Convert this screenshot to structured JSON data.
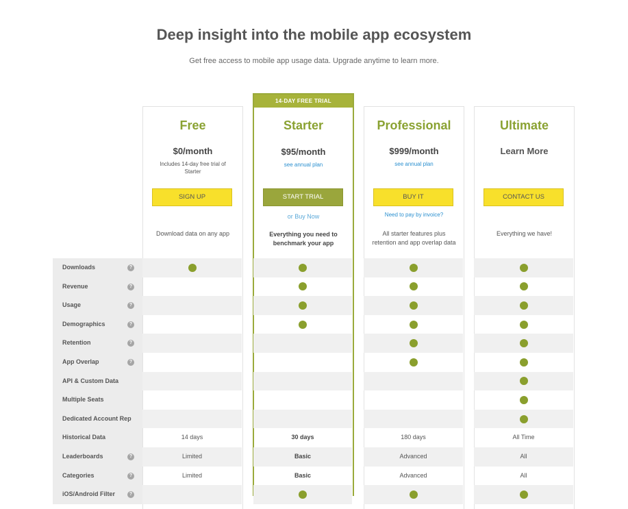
{
  "header": {
    "title": "Deep insight into the mobile app ecosystem",
    "subtitle": "Get free access to mobile app usage data. Upgrade anytime to learn more."
  },
  "plans": [
    {
      "name": "Free",
      "price": "$0/month",
      "note": "Includes 14-day free trial of Starter",
      "button": "SIGN UP",
      "description": "Download data on any app"
    },
    {
      "banner": "14-DAY FREE TRIAL",
      "name": "Starter",
      "price": "$95/month",
      "link": "see annual plan",
      "button": "START TRIAL",
      "sublink": "or Buy Now",
      "description": "Everything you need to benchmark your app"
    },
    {
      "name": "Professional",
      "price": "$999/month",
      "link": "see annual plan",
      "button": "BUY IT",
      "sublink": "Need to pay by invoice?",
      "description": "All starter features plus retention and app overlap data"
    },
    {
      "name": "Ultimate",
      "price": "Learn More",
      "button": "CONTACT US",
      "description": "Everything we have!"
    }
  ],
  "help_symbol": "?",
  "features": [
    {
      "label": "Downloads",
      "help": true,
      "values": [
        "dot",
        "dot",
        "dot",
        "dot"
      ]
    },
    {
      "label": "Revenue",
      "help": true,
      "values": [
        "",
        "dot",
        "dot",
        "dot"
      ]
    },
    {
      "label": "Usage",
      "help": true,
      "values": [
        "",
        "dot",
        "dot",
        "dot"
      ]
    },
    {
      "label": "Demographics",
      "help": true,
      "values": [
        "",
        "dot",
        "dot",
        "dot"
      ]
    },
    {
      "label": "Retention",
      "help": true,
      "values": [
        "",
        "",
        "dot",
        "dot"
      ]
    },
    {
      "label": "App Overlap",
      "help": true,
      "values": [
        "",
        "",
        "dot",
        "dot"
      ]
    },
    {
      "label": "API & Custom Data",
      "help": false,
      "values": [
        "",
        "",
        "",
        "dot"
      ]
    },
    {
      "label": "Multiple Seats",
      "help": false,
      "values": [
        "",
        "",
        "",
        "dot"
      ]
    },
    {
      "label": "Dedicated Account Rep",
      "help": false,
      "values": [
        "",
        "",
        "",
        "dot"
      ]
    },
    {
      "label": "Historical Data",
      "help": false,
      "values": [
        "14 days",
        "30 days",
        "180 days",
        "All Time"
      ]
    },
    {
      "label": "Leaderboards",
      "help": true,
      "values": [
        "Limited",
        "Basic",
        "Advanced",
        "All"
      ]
    },
    {
      "label": "Categories",
      "help": true,
      "values": [
        "Limited",
        "Basic",
        "Advanced",
        "All"
      ]
    },
    {
      "label": "iOS/Android Filter",
      "help": true,
      "values": [
        "",
        "dot",
        "dot",
        "dot"
      ]
    }
  ],
  "colors": {
    "accent": "#8aa232",
    "button_yellow": "#f8e02b",
    "button_olive": "#9aa63c",
    "link": "#2a8fcf",
    "dot": "#8a9f2d"
  }
}
